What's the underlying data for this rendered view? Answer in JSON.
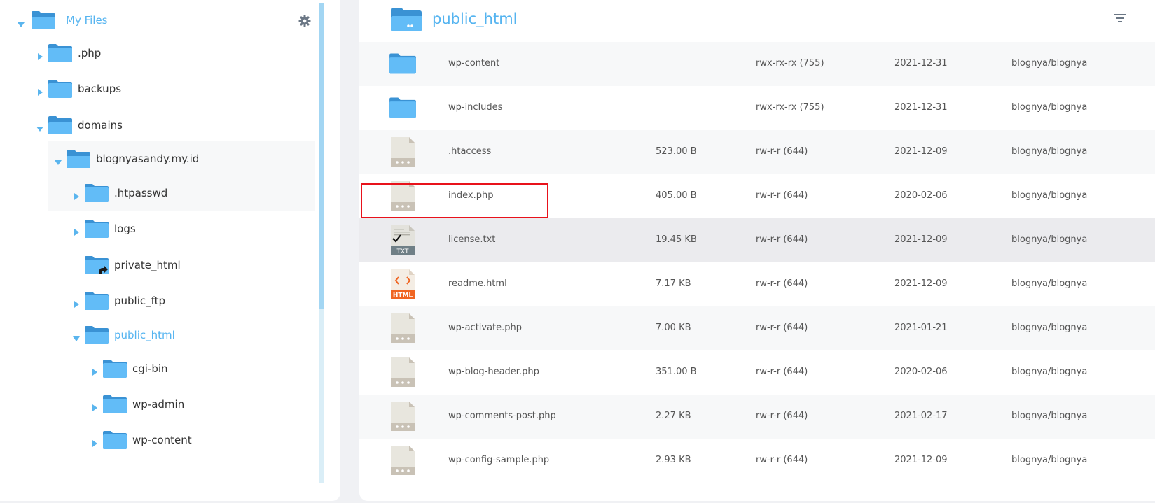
{
  "tree": {
    "root_label": "My Files",
    "nodes": [
      {
        "label": ".php",
        "arrow": "right",
        "folder": "closed"
      },
      {
        "label": "backups",
        "arrow": "right",
        "folder": "closed"
      },
      {
        "label": "domains",
        "arrow": "down",
        "folder": "open"
      },
      {
        "label": "blognyasandy.my.id",
        "arrow": "down",
        "folder": "open"
      },
      {
        "label": ".htpasswd",
        "arrow": "right",
        "folder": "closed"
      },
      {
        "label": "logs",
        "arrow": "right",
        "folder": "closed"
      },
      {
        "label": "private_html",
        "arrow": "none",
        "folder": "link"
      },
      {
        "label": "public_ftp",
        "arrow": "right",
        "folder": "closed"
      },
      {
        "label": "public_html",
        "arrow": "down",
        "folder": "open",
        "active": true
      },
      {
        "label": "cgi-bin",
        "arrow": "right",
        "folder": "closed"
      },
      {
        "label": "wp-admin",
        "arrow": "right",
        "folder": "closed"
      },
      {
        "label": "wp-content",
        "arrow": "right",
        "folder": "closed"
      }
    ]
  },
  "header": {
    "title": "public_html"
  },
  "files": [
    {
      "name": "wp-content",
      "type": "folder",
      "size": "",
      "perm": "rwx-rx-rx (755)",
      "date": "2021-12-31",
      "owner": "blognya/blognya"
    },
    {
      "name": "wp-includes",
      "type": "folder",
      "size": "",
      "perm": "rwx-rx-rx (755)",
      "date": "2021-12-31",
      "owner": "blognya/blognya"
    },
    {
      "name": ".htaccess",
      "type": "file",
      "size": "523.00 B",
      "perm": "rw-r-r (644)",
      "date": "2021-12-09",
      "owner": "blognya/blognya"
    },
    {
      "name": "index.php",
      "type": "file",
      "size": "405.00 B",
      "perm": "rw-r-r (644)",
      "date": "2020-02-06",
      "owner": "blognya/blognya"
    },
    {
      "name": "license.txt",
      "type": "txt",
      "size": "19.45 KB",
      "perm": "rw-r-r (644)",
      "date": "2021-12-09",
      "owner": "blognya/blognya",
      "selected": true
    },
    {
      "name": "readme.html",
      "type": "html",
      "size": "7.17 KB",
      "perm": "rw-r-r (644)",
      "date": "2021-12-09",
      "owner": "blognya/blognya"
    },
    {
      "name": "wp-activate.php",
      "type": "file",
      "size": "7.00 KB",
      "perm": "rw-r-r (644)",
      "date": "2021-01-21",
      "owner": "blognya/blognya"
    },
    {
      "name": "wp-blog-header.php",
      "type": "file",
      "size": "351.00 B",
      "perm": "rw-r-r (644)",
      "date": "2020-02-06",
      "owner": "blognya/blognya"
    },
    {
      "name": "wp-comments-post.php",
      "type": "file",
      "size": "2.27 KB",
      "perm": "rw-r-r (644)",
      "date": "2021-02-17",
      "owner": "blognya/blognya"
    },
    {
      "name": "wp-config-sample.php",
      "type": "file",
      "size": "2.93 KB",
      "perm": "rw-r-r (644)",
      "date": "2021-12-09",
      "owner": "blognya/blognya"
    }
  ],
  "icons": {
    "folder": "folder-icon",
    "folder_open": "folder-open-icon",
    "file": "generic-file-icon",
    "txt": "txt-file-icon",
    "html": "html-file-icon",
    "txt_badge": "TXT",
    "html_badge": "HTML",
    "gear": "gear-icon",
    "filter": "filter-icon"
  },
  "colors": {
    "accent": "#55b4f0",
    "folder": "#62bcf7",
    "folder_dark": "#3a92d4",
    "file_body": "#e8e6de",
    "file_fold": "#c9c2b6",
    "html_orange": "#f06522",
    "highlight": "#e8121b"
  }
}
